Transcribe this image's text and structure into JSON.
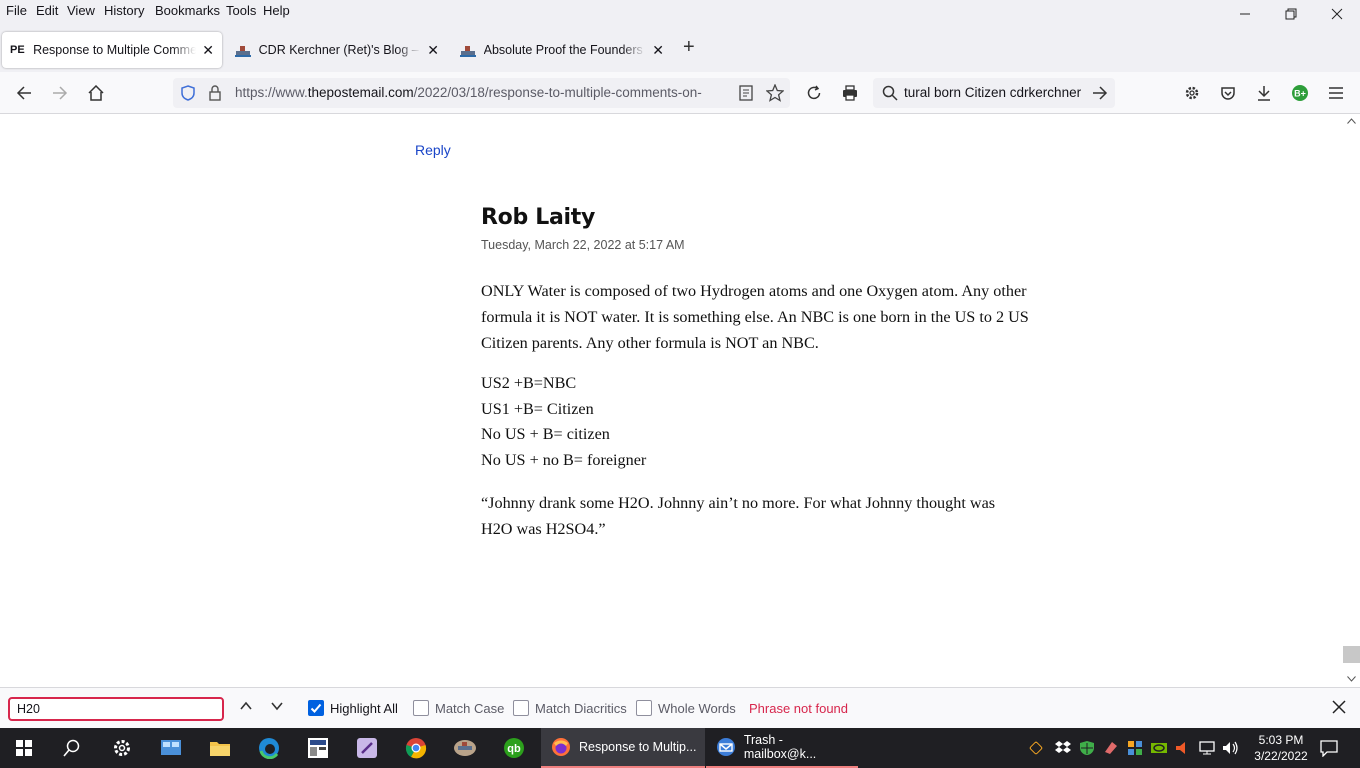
{
  "menu": [
    "File",
    "Edit",
    "View",
    "History",
    "Bookmarks",
    "Tools",
    "Help"
  ],
  "tabs": [
    {
      "favicon": "PE",
      "title": "Response to Multiple Comments on Facebook"
    },
    {
      "favicon": "",
      "title": "CDR Kerchner (Ret)'s Blog – Protect"
    },
    {
      "favicon": "",
      "title": "Absolute Proof the Founders Knew"
    }
  ],
  "url": {
    "prefix": "https://www.",
    "domain": "thepostemail.com",
    "path": "/2022/03/18/response-to-multiple-comments-on-"
  },
  "search": {
    "query": "tural born Citizen cdrkerchner"
  },
  "page": {
    "reply_label": "Reply",
    "comment": {
      "author": "Rob Laity",
      "date": "Tuesday, March 22, 2022 at 5:17 AM",
      "p1": "ONLY Water is composed of two Hydrogen atoms and one Oxygen atom. Any other formula it is NOT water. It is something else. An NBC is one born in the US to 2 US Citizen parents. Any other formula is NOT an NBC.",
      "formulas": [
        "US2 +B=NBC",
        "US1 +B= Citizen",
        "No US + B= citizen",
        "No US + no B= foreigner"
      ],
      "p3": "“Johnny drank some H2O. Johnny ain’t no more. For what Johnny thought was H2O was H2SO4.”"
    }
  },
  "findbar": {
    "query": "H20",
    "highlight_all": "Highlight All",
    "match_case": "Match Case",
    "match_diacritics": "Match Diacritics",
    "whole_words": "Whole Words",
    "status": "Phrase not found",
    "highlight_all_checked": true
  },
  "taskbar": {
    "apps": [
      {
        "name": "Response to Multip...",
        "active": true
      },
      {
        "name": "Trash - mailbox@k...",
        "active": false
      }
    ],
    "time": "5:03 PM",
    "date": "3/22/2022"
  },
  "colors": {
    "link": "#1b46c8",
    "alert": "#d7264c",
    "checkbox": "#0061e0",
    "taskbar": "#1f1f23"
  }
}
